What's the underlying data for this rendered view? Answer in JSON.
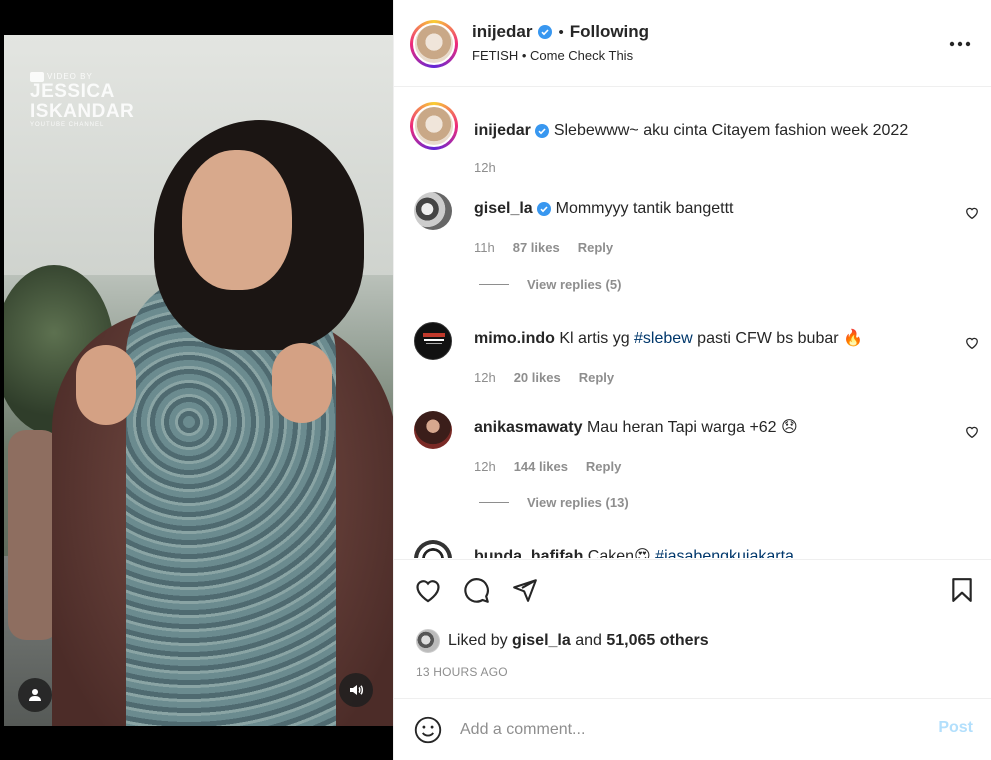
{
  "media": {
    "watermark_top": "VIDEO BY",
    "watermark_name_1": "JESSICA",
    "watermark_name_2": "ISKANDAR",
    "watermark_sub": "YOUTUBE CHANNEL",
    "user_icon": "person-icon",
    "audio_icon": "speaker-icon"
  },
  "header": {
    "username": "inijedar",
    "separator": "•",
    "follow_status": "Following",
    "audio_label": "FETISH • Come Check This",
    "more_icon": "more-horizontal-icon"
  },
  "caption": {
    "username": "inijedar",
    "text": "Slebewww~ aku cinta Citayem fashion week 2022",
    "time": "12h"
  },
  "comments": [
    {
      "username": "gisel_la",
      "verified": true,
      "text": "Mommyyy tantik bangettt",
      "time": "11h",
      "likes": "87 likes",
      "reply": "Reply",
      "view_replies": "View replies (5)"
    },
    {
      "username": "mimo.indo",
      "verified": false,
      "text_before": "Kl artis yg ",
      "hashtag": "#slebew",
      "text_after": " pasti CFW bs bubar 🔥",
      "time": "12h",
      "likes": "20 likes",
      "reply": "Reply"
    },
    {
      "username": "anikasmawaty",
      "verified": false,
      "text": "Mau heran Tapi warga +62 😞",
      "time": "12h",
      "likes": "144 likes",
      "reply": "Reply",
      "view_replies": "View replies (13)"
    },
    {
      "username": "bunda_hafifah",
      "verified": false,
      "text_before": "Caken😍 ",
      "hashtag": "#jasabengkujakarta"
    }
  ],
  "actions": {
    "like_icon": "heart-icon",
    "comment_icon": "comment-icon",
    "share_icon": "send-icon",
    "save_icon": "bookmark-icon",
    "liked_by_prefix": "Liked by ",
    "liked_by_user": "gisel_la",
    "liked_by_mid": " and ",
    "liked_by_others": "51,065 others",
    "timestamp": "13 HOURS AGO"
  },
  "add_comment": {
    "emoji_icon": "smiley-icon",
    "placeholder": "Add a comment...",
    "post_label": "Post"
  },
  "colors": {
    "verified_blue": "#3897f0",
    "hashtag": "#00376b",
    "post_disabled": "#b2dffc",
    "muted": "#8e8e8e"
  }
}
